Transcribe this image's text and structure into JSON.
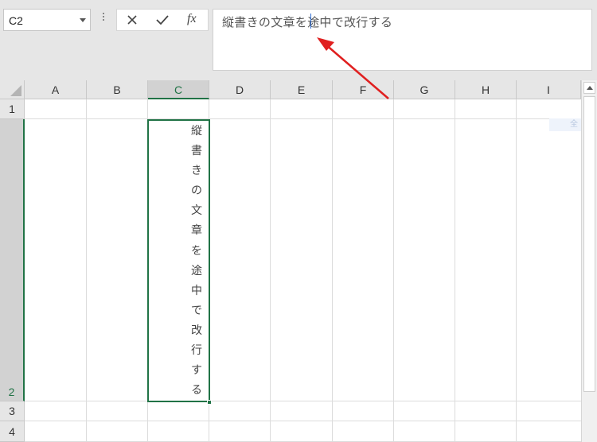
{
  "namebox": {
    "value": "C2"
  },
  "formula_bar": {
    "cancel_icon": "close-icon",
    "enter_icon": "check-icon",
    "fx_label": "fx",
    "text": "縦書きの文章を途中で改行する"
  },
  "columns": [
    "A",
    "B",
    "C",
    "D",
    "E",
    "F",
    "G",
    "H",
    "I"
  ],
  "selected_column": "C",
  "rows": [
    "1",
    "2",
    "3",
    "4"
  ],
  "selected_row": "2",
  "cell_c2": {
    "chars": [
      "縦",
      "書",
      "き",
      "の",
      "文",
      "章",
      "を",
      "途",
      "中",
      "で",
      "改",
      "行",
      "す",
      "る"
    ]
  },
  "ghost_tooltip": "全画面",
  "colors": {
    "accent": "#217346",
    "arrow": "#e02020"
  }
}
